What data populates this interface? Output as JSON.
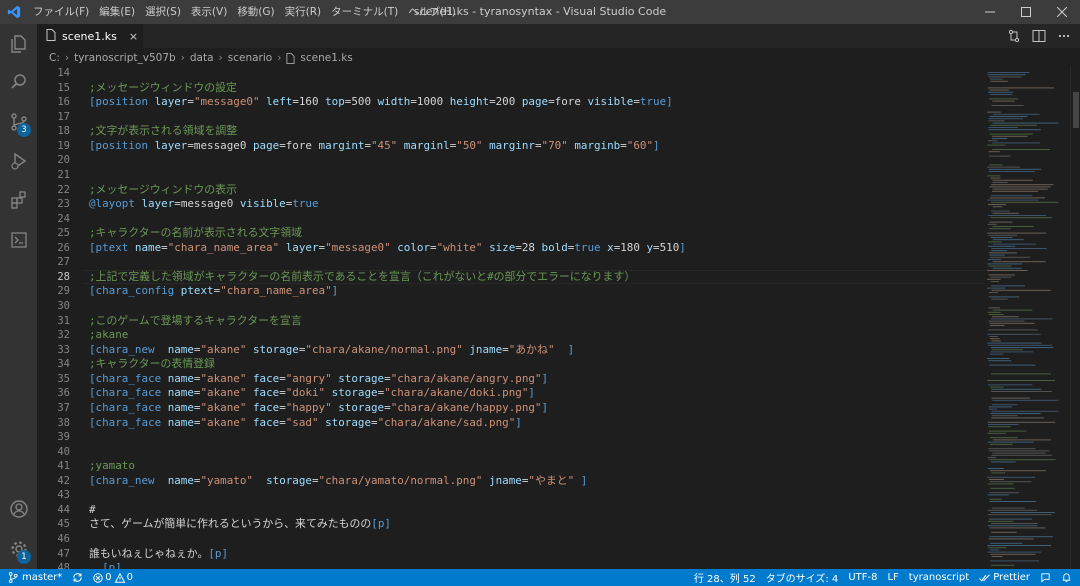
{
  "window": {
    "title": "scene1.ks - tyranosyntax - Visual Studio Code",
    "menu": [
      "ファイル(F)",
      "編集(E)",
      "選択(S)",
      "表示(V)",
      "移動(G)",
      "実行(R)",
      "ターミナル(T)",
      "ヘルプ(H)"
    ]
  },
  "activity": {
    "icons": [
      "explorer-icon",
      "search-icon",
      "source-control-icon",
      "run-debug-icon",
      "extensions-icon",
      "remote-explorer-icon",
      "account-icon",
      "settings-gear-icon"
    ],
    "source_control_badge": "3",
    "settings_badge": "1"
  },
  "tab": {
    "filename": "scene1.ks",
    "close": "×"
  },
  "breadcrumb": [
    "C:",
    "tyranoscript_v507b",
    "data",
    "scenario",
    "scene1.ks"
  ],
  "editor": {
    "current_line": 28,
    "lines": [
      {
        "n": "14",
        "tokens": []
      },
      {
        "n": "15",
        "tokens": [
          [
            "c-comment",
            ";メッセージウィンドウの設定"
          ]
        ]
      },
      {
        "n": "16",
        "tokens": [
          [
            "c-tag",
            "[position "
          ],
          [
            "c-attr",
            "layer"
          ],
          [
            "c-plain",
            "="
          ],
          [
            "c-str",
            "\"message0\""
          ],
          [
            "c-plain",
            " "
          ],
          [
            "c-attr",
            "left"
          ],
          [
            "c-plain",
            "=160 "
          ],
          [
            "c-attr",
            "top"
          ],
          [
            "c-plain",
            "=500 "
          ],
          [
            "c-attr",
            "width"
          ],
          [
            "c-plain",
            "=1000 "
          ],
          [
            "c-attr",
            "height"
          ],
          [
            "c-plain",
            "=200 "
          ],
          [
            "c-attr",
            "page"
          ],
          [
            "c-plain",
            "=fore "
          ],
          [
            "c-attr",
            "visible"
          ],
          [
            "c-plain",
            "="
          ],
          [
            "c-kw",
            "true"
          ],
          [
            "c-tag",
            "]"
          ]
        ]
      },
      {
        "n": "17",
        "tokens": []
      },
      {
        "n": "18",
        "tokens": [
          [
            "c-comment",
            ";文字が表示される領域を調整"
          ]
        ]
      },
      {
        "n": "19",
        "tokens": [
          [
            "c-tag",
            "[position "
          ],
          [
            "c-attr",
            "layer"
          ],
          [
            "c-plain",
            "=message0 "
          ],
          [
            "c-attr",
            "page"
          ],
          [
            "c-plain",
            "=fore "
          ],
          [
            "c-attr",
            "margint"
          ],
          [
            "c-plain",
            "="
          ],
          [
            "c-str",
            "\"45\""
          ],
          [
            "c-plain",
            " "
          ],
          [
            "c-attr",
            "marginl"
          ],
          [
            "c-plain",
            "="
          ],
          [
            "c-str",
            "\"50\""
          ],
          [
            "c-plain",
            " "
          ],
          [
            "c-attr",
            "marginr"
          ],
          [
            "c-plain",
            "="
          ],
          [
            "c-str",
            "\"70\""
          ],
          [
            "c-plain",
            " "
          ],
          [
            "c-attr",
            "marginb"
          ],
          [
            "c-plain",
            "="
          ],
          [
            "c-str",
            "\"60\""
          ],
          [
            "c-tag",
            "]"
          ]
        ]
      },
      {
        "n": "20",
        "tokens": []
      },
      {
        "n": "21",
        "tokens": []
      },
      {
        "n": "22",
        "tokens": [
          [
            "c-comment",
            ";メッセージウィンドウの表示"
          ]
        ]
      },
      {
        "n": "23",
        "tokens": [
          [
            "c-tag",
            "@layopt "
          ],
          [
            "c-attr",
            "layer"
          ],
          [
            "c-plain",
            "=message0 "
          ],
          [
            "c-attr",
            "visible"
          ],
          [
            "c-plain",
            "="
          ],
          [
            "c-kw",
            "true"
          ]
        ]
      },
      {
        "n": "24",
        "tokens": []
      },
      {
        "n": "25",
        "tokens": [
          [
            "c-comment",
            ";キャラクターの名前が表示される文字領域"
          ]
        ]
      },
      {
        "n": "26",
        "tokens": [
          [
            "c-tag",
            "[ptext "
          ],
          [
            "c-attr",
            "name"
          ],
          [
            "c-plain",
            "="
          ],
          [
            "c-str",
            "\"chara_name_area\""
          ],
          [
            "c-plain",
            " "
          ],
          [
            "c-attr",
            "layer"
          ],
          [
            "c-plain",
            "="
          ],
          [
            "c-str",
            "\"message0\""
          ],
          [
            "c-plain",
            " "
          ],
          [
            "c-attr",
            "color"
          ],
          [
            "c-plain",
            "="
          ],
          [
            "c-str",
            "\"white\""
          ],
          [
            "c-plain",
            " "
          ],
          [
            "c-attr",
            "size"
          ],
          [
            "c-plain",
            "=28 "
          ],
          [
            "c-attr",
            "bold"
          ],
          [
            "c-plain",
            "="
          ],
          [
            "c-kw",
            "true"
          ],
          [
            "c-plain",
            " "
          ],
          [
            "c-attr",
            "x"
          ],
          [
            "c-plain",
            "=180 "
          ],
          [
            "c-attr",
            "y"
          ],
          [
            "c-plain",
            "=510"
          ],
          [
            "c-tag",
            "]"
          ]
        ]
      },
      {
        "n": "27",
        "tokens": []
      },
      {
        "n": "28",
        "tokens": [
          [
            "c-comment",
            ";上記で定義した領域がキャラクターの名前表示であることを宣言（これがないと#の部分でエラーになります）"
          ]
        ]
      },
      {
        "n": "29",
        "tokens": [
          [
            "c-tag",
            "[chara_config "
          ],
          [
            "c-attr",
            "ptext"
          ],
          [
            "c-plain",
            "="
          ],
          [
            "c-str",
            "\"chara_name_area\""
          ],
          [
            "c-tag",
            "]"
          ]
        ]
      },
      {
        "n": "30",
        "tokens": []
      },
      {
        "n": "31",
        "tokens": [
          [
            "c-comment",
            ";このゲームで登場するキャラクターを宣言"
          ]
        ]
      },
      {
        "n": "32",
        "tokens": [
          [
            "c-comment",
            ";akane"
          ]
        ]
      },
      {
        "n": "33",
        "tokens": [
          [
            "c-tag",
            "[chara_new  "
          ],
          [
            "c-attr",
            "name"
          ],
          [
            "c-plain",
            "="
          ],
          [
            "c-str",
            "\"akane\""
          ],
          [
            "c-plain",
            " "
          ],
          [
            "c-attr",
            "storage"
          ],
          [
            "c-plain",
            "="
          ],
          [
            "c-str",
            "\"chara/akane/normal.png\""
          ],
          [
            "c-plain",
            " "
          ],
          [
            "c-attr",
            "jname"
          ],
          [
            "c-plain",
            "="
          ],
          [
            "c-str",
            "\"あかね\""
          ],
          [
            "c-plain",
            "  "
          ],
          [
            "c-tag",
            "]"
          ]
        ]
      },
      {
        "n": "34",
        "tokens": [
          [
            "c-comment",
            ";キャラクターの表情登録"
          ]
        ]
      },
      {
        "n": "35",
        "tokens": [
          [
            "c-tag",
            "[chara_face "
          ],
          [
            "c-attr",
            "name"
          ],
          [
            "c-plain",
            "="
          ],
          [
            "c-str",
            "\"akane\""
          ],
          [
            "c-plain",
            " "
          ],
          [
            "c-attr",
            "face"
          ],
          [
            "c-plain",
            "="
          ],
          [
            "c-str",
            "\"angry\""
          ],
          [
            "c-plain",
            " "
          ],
          [
            "c-attr",
            "storage"
          ],
          [
            "c-plain",
            "="
          ],
          [
            "c-str",
            "\"chara/akane/angry.png\""
          ],
          [
            "c-tag",
            "]"
          ]
        ]
      },
      {
        "n": "36",
        "tokens": [
          [
            "c-tag",
            "[chara_face "
          ],
          [
            "c-attr",
            "name"
          ],
          [
            "c-plain",
            "="
          ],
          [
            "c-str",
            "\"akane\""
          ],
          [
            "c-plain",
            " "
          ],
          [
            "c-attr",
            "face"
          ],
          [
            "c-plain",
            "="
          ],
          [
            "c-str",
            "\"doki\""
          ],
          [
            "c-plain",
            " "
          ],
          [
            "c-attr",
            "storage"
          ],
          [
            "c-plain",
            "="
          ],
          [
            "c-str",
            "\"chara/akane/doki.png\""
          ],
          [
            "c-tag",
            "]"
          ]
        ]
      },
      {
        "n": "37",
        "tokens": [
          [
            "c-tag",
            "[chara_face "
          ],
          [
            "c-attr",
            "name"
          ],
          [
            "c-plain",
            "="
          ],
          [
            "c-str",
            "\"akane\""
          ],
          [
            "c-plain",
            " "
          ],
          [
            "c-attr",
            "face"
          ],
          [
            "c-plain",
            "="
          ],
          [
            "c-str",
            "\"happy\""
          ],
          [
            "c-plain",
            " "
          ],
          [
            "c-attr",
            "storage"
          ],
          [
            "c-plain",
            "="
          ],
          [
            "c-str",
            "\"chara/akane/happy.png\""
          ],
          [
            "c-tag",
            "]"
          ]
        ]
      },
      {
        "n": "38",
        "tokens": [
          [
            "c-tag",
            "[chara_face "
          ],
          [
            "c-attr",
            "name"
          ],
          [
            "c-plain",
            "="
          ],
          [
            "c-str",
            "\"akane\""
          ],
          [
            "c-plain",
            " "
          ],
          [
            "c-attr",
            "face"
          ],
          [
            "c-plain",
            "="
          ],
          [
            "c-str",
            "\"sad\""
          ],
          [
            "c-plain",
            " "
          ],
          [
            "c-attr",
            "storage"
          ],
          [
            "c-plain",
            "="
          ],
          [
            "c-str",
            "\"chara/akane/sad.png\""
          ],
          [
            "c-tag",
            "]"
          ]
        ]
      },
      {
        "n": "39",
        "tokens": []
      },
      {
        "n": "40",
        "tokens": []
      },
      {
        "n": "41",
        "tokens": [
          [
            "c-comment",
            ";yamato"
          ]
        ]
      },
      {
        "n": "42",
        "tokens": [
          [
            "c-tag",
            "[chara_new  "
          ],
          [
            "c-attr",
            "name"
          ],
          [
            "c-plain",
            "="
          ],
          [
            "c-str",
            "\"yamato\""
          ],
          [
            "c-plain",
            "  "
          ],
          [
            "c-attr",
            "storage"
          ],
          [
            "c-plain",
            "="
          ],
          [
            "c-str",
            "\"chara/yamato/normal.png\""
          ],
          [
            "c-plain",
            " "
          ],
          [
            "c-attr",
            "jname"
          ],
          [
            "c-plain",
            "="
          ],
          [
            "c-str",
            "\"やまと\""
          ],
          [
            "c-plain",
            " "
          ],
          [
            "c-tag",
            "]"
          ]
        ]
      },
      {
        "n": "43",
        "tokens": []
      },
      {
        "n": "44",
        "tokens": [
          [
            "c-plain",
            "#"
          ]
        ]
      },
      {
        "n": "45",
        "tokens": [
          [
            "c-plain",
            "さて、ゲームが簡単に作れるというから、来てみたものの"
          ],
          [
            "c-tag",
            "[p]"
          ]
        ]
      },
      {
        "n": "46",
        "tokens": []
      },
      {
        "n": "47",
        "tokens": [
          [
            "c-plain",
            "誰もいねぇじゃねぇか。"
          ],
          [
            "c-tag",
            "[p]"
          ]
        ]
      },
      {
        "n": "48",
        "tokens": [
          [
            "c-plain",
            "……"
          ],
          [
            "c-tag",
            "[p]"
          ]
        ]
      }
    ]
  },
  "statusbar": {
    "branch": "master*",
    "errors": "0",
    "warnings": "0",
    "position": "行 28、列 52",
    "tab_size": "タブのサイズ: 4",
    "encoding": "UTF-8",
    "eol": "LF",
    "language": "tyranoscript",
    "formatter": "Prettier"
  },
  "colors": {
    "statusbar": "#007acc",
    "badge": "#0e639c",
    "comment": "#6a9955",
    "tag": "#569cd6",
    "attr": "#9cdcfe",
    "string": "#ce9178"
  }
}
